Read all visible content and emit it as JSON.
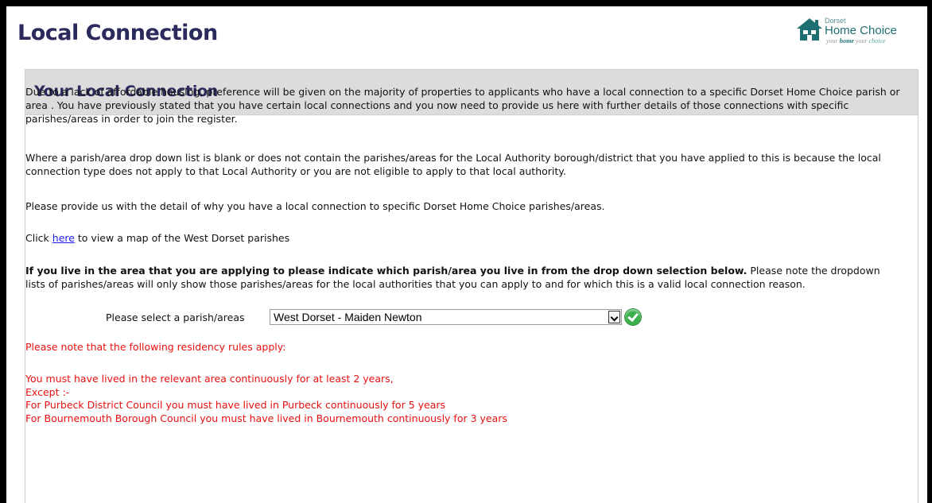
{
  "page": {
    "title": "Local Connection"
  },
  "logo": {
    "small_text": "Dorset",
    "main_text": "Home Choice",
    "tagline_pre": "your ",
    "tagline_home": "home",
    "tagline_mid": " your ",
    "tagline_choice": "choice"
  },
  "panel": {
    "title": "Your Local Connection"
  },
  "content": {
    "para1": "Due to a lack of affordable housing, preference will be given on the majority of properties to applicants who have a local connection to a specific Dorset Home Choice parish or area . You have previously stated that you have certain local connections and you now need to provide us here with further details of those connections with specific parishes/areas in order to join the register.",
    "para2": "Where a parish/area drop down list is blank or does not contain the parishes/areas for the Local Authority borough/district that you have applied to this is because the local connection type does not apply to that Local Authority or you are not eligible to apply to that local authority.",
    "para3": "Please provide us with the detail of why you have a local connection to specific Dorset Home Choice parishes/areas.",
    "para4_pre": "Click ",
    "para4_link": "here",
    "para4_post": " to view a map of the West Dorset parishes",
    "para5_bold": "If you live in the area that you are applying to please indicate which parish/area you live in from the drop down selection below.",
    "para5_rest": " Please note the dropdown lists of parishes/areas will only show those parishes/areas for the local authorities that you can apply to and for which this is a valid local connection reason.",
    "select_label": "Please select a parish/areas",
    "select_value": "West Dorset - Maiden Newton",
    "residency_note": "Please note that the following residency rules apply:",
    "rules": [
      "You must have lived in the relevant area continuously for at least 2 years,",
      "Except :-",
      "For Purbeck District Council you must have lived in Purbeck continuously for 5 years",
      "For Bournemouth Borough Council you must have lived in Bournemouth continuously for 3 years"
    ]
  },
  "colors": {
    "title": "#2b2a5c",
    "notice_red": "#e81010",
    "link": "#1a1aee",
    "header_bg": "#dcdcdc",
    "brand_teal": "#1f6f72",
    "check_green": "#3bb04a"
  }
}
